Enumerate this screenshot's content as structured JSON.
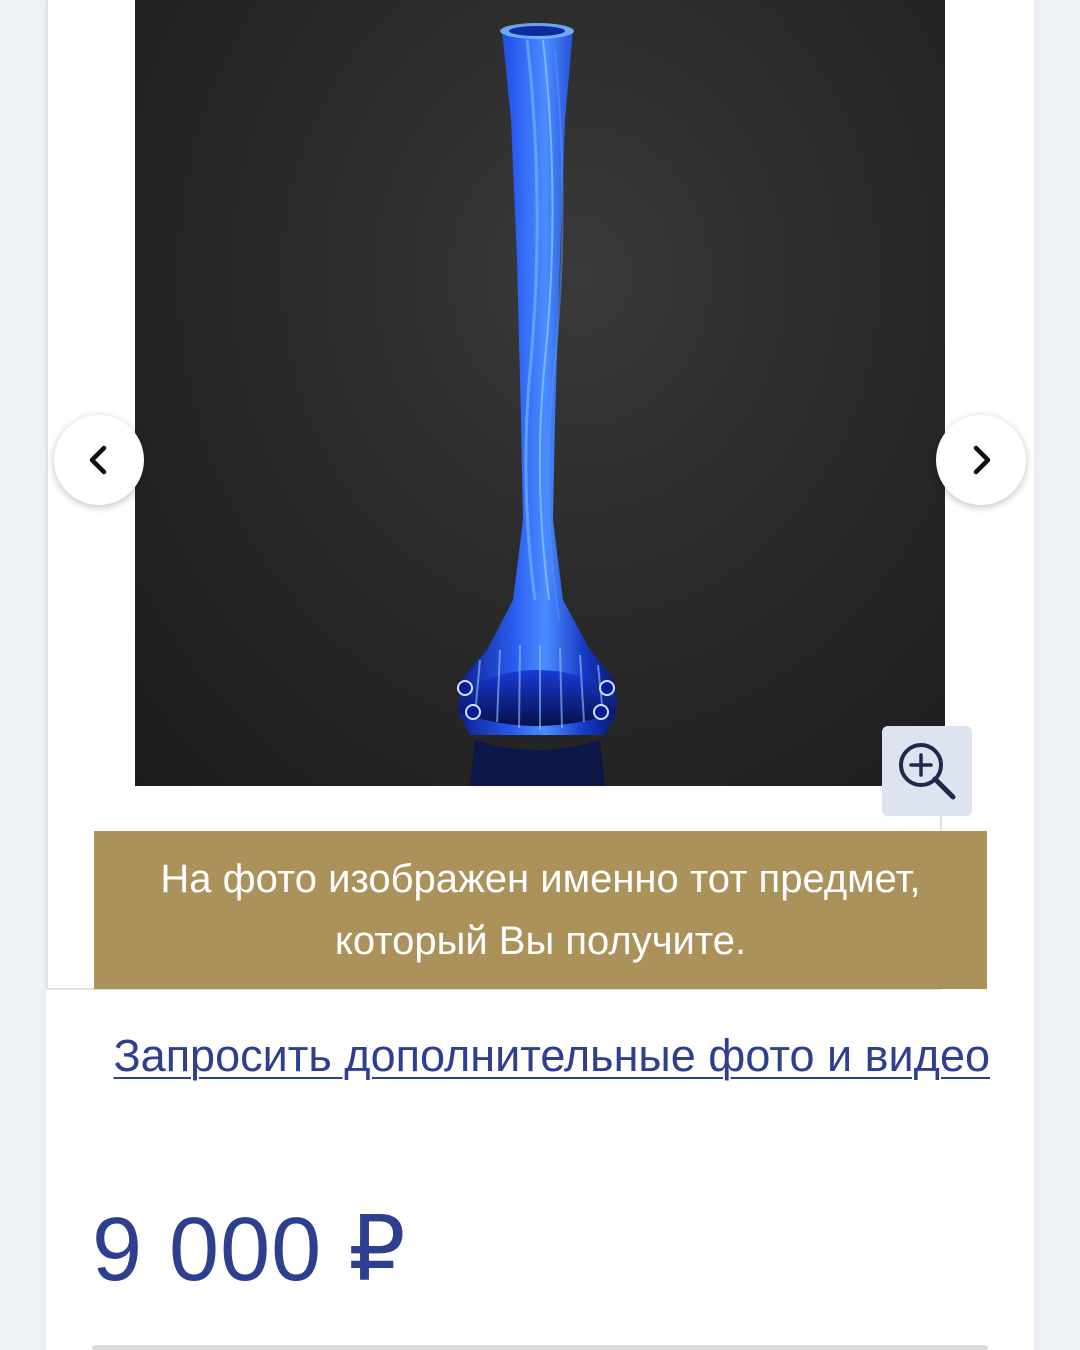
{
  "gallery": {
    "image_alt": "blue-glass-vase",
    "prev_icon": "chevron-left-icon",
    "next_icon": "chevron-right-icon",
    "zoom_icon": "zoom-in-icon",
    "background_color": "#2a2a2b",
    "vase_color": "#1f3fd6"
  },
  "notice": {
    "line1": "На фото изображен именно тот предмет,",
    "line2": "который Вы получите.",
    "background_color": "#ab925a"
  },
  "request_link": {
    "label": "Запросить дополнительные фото и видео"
  },
  "price": {
    "value": "9 000 ₽",
    "color": "#2f3f8f"
  }
}
